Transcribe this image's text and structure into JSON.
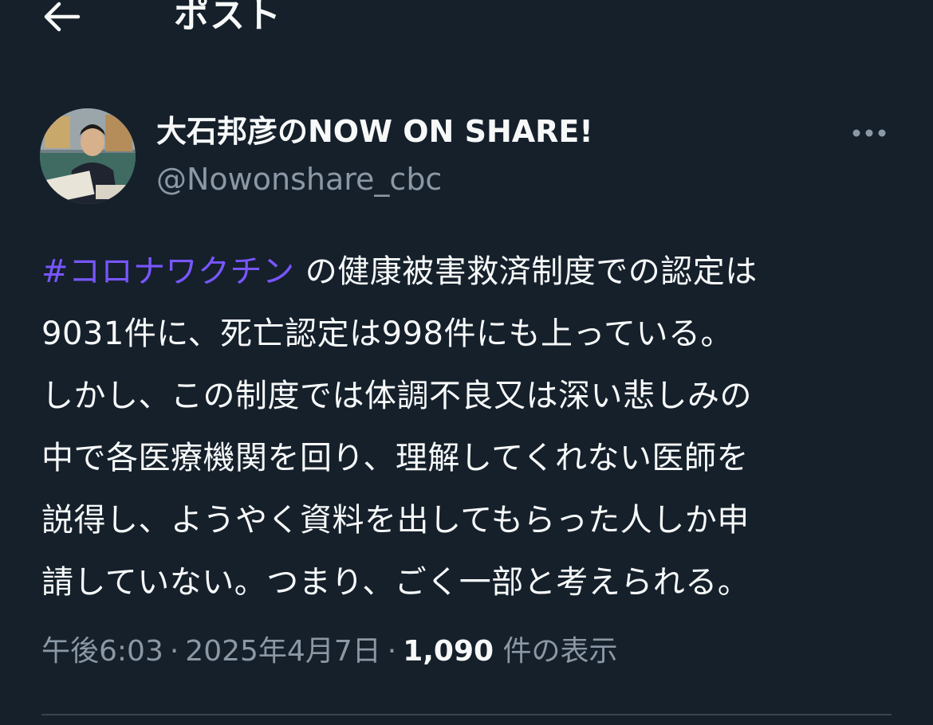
{
  "header": {
    "title": "ポスト",
    "back_icon": "arrow-left-icon"
  },
  "author": {
    "display_name": "大石邦彦のNOW ON SHARE!",
    "handle": "@Nowonshare_cbc",
    "avatar_icon": "avatar-photo",
    "more_icon": "more-horizontal-icon"
  },
  "post": {
    "hashtag": "#コロナワクチン",
    "lines": [
      " の健康被害救済制度での認定は",
      "9031件に、死亡認定は998件にも上っている。",
      "しかし、この制度では体調不良又は深い悲しみの",
      "中で各医療機関を回り、理解してくれない医師を",
      "説得し、ようやく資料を出してもらった人しか申",
      "請していない。つまり、ごく一部と考えられる。"
    ]
  },
  "meta": {
    "time": "午後6:03",
    "separator": "·",
    "date": "2025年4月7日",
    "views_count": "1,090",
    "views_label": "件の表示"
  },
  "colors": {
    "background": "#15202b",
    "text": "#f7f9f9",
    "secondary": "#8b98a5",
    "hashtag": "#7856ff",
    "divider": "#38444d"
  }
}
